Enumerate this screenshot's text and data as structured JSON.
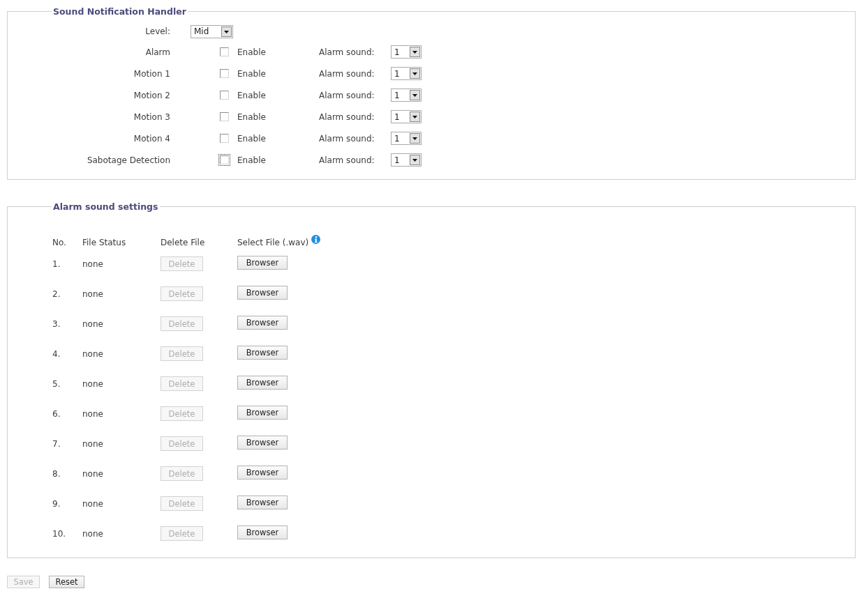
{
  "sound_notification_handler": {
    "title": "Sound Notification Handler",
    "level": {
      "label": "Level:",
      "value": "Mid"
    },
    "events": [
      {
        "name": "Alarm",
        "checked": false,
        "focused": false,
        "checkbox_label": "Enable",
        "sound_label": "Alarm sound:",
        "sound": "1"
      },
      {
        "name": "Motion 1",
        "checked": false,
        "focused": false,
        "checkbox_label": "Enable",
        "sound_label": "Alarm sound:",
        "sound": "1"
      },
      {
        "name": "Motion 2",
        "checked": false,
        "focused": false,
        "checkbox_label": "Enable",
        "sound_label": "Alarm sound:",
        "sound": "1"
      },
      {
        "name": "Motion 3",
        "checked": false,
        "focused": false,
        "checkbox_label": "Enable",
        "sound_label": "Alarm sound:",
        "sound": "1"
      },
      {
        "name": "Motion 4",
        "checked": false,
        "focused": false,
        "checkbox_label": "Enable",
        "sound_label": "Alarm sound:",
        "sound": "1"
      },
      {
        "name": "Sabotage Detection",
        "checked": false,
        "focused": true,
        "checkbox_label": "Enable",
        "sound_label": "Alarm sound:",
        "sound": "1"
      }
    ]
  },
  "alarm_sound_settings": {
    "title": "Alarm sound settings",
    "columns": [
      "No.",
      "File Status",
      "Delete File",
      "Select File (.wav)"
    ],
    "rows": [
      {
        "no": "1.",
        "status": "none",
        "delete": {
          "label": "Delete",
          "disabled": true
        },
        "select": "Browser"
      },
      {
        "no": "2.",
        "status": "none",
        "delete": {
          "label": "Delete",
          "disabled": true
        },
        "select": "Browser"
      },
      {
        "no": "3.",
        "status": "none",
        "delete": {
          "label": "Delete",
          "disabled": true
        },
        "select": "Browser"
      },
      {
        "no": "4.",
        "status": "none",
        "delete": {
          "label": "Delete",
          "disabled": true
        },
        "select": "Browser"
      },
      {
        "no": "5.",
        "status": "none",
        "delete": {
          "label": "Delete",
          "disabled": true
        },
        "select": "Browser"
      },
      {
        "no": "6.",
        "status": "none",
        "delete": {
          "label": "Delete",
          "disabled": true
        },
        "select": "Browser"
      },
      {
        "no": "7.",
        "status": "none",
        "delete": {
          "label": "Delete",
          "disabled": true
        },
        "select": "Browser"
      },
      {
        "no": "8.",
        "status": "none",
        "delete": {
          "label": "Delete",
          "disabled": true
        },
        "select": "Browser"
      },
      {
        "no": "9.",
        "status": "none",
        "delete": {
          "label": "Delete",
          "disabled": true
        },
        "select": "Browser"
      },
      {
        "no": "10.",
        "status": "none",
        "delete": {
          "label": "Delete",
          "disabled": true
        },
        "select": "Browser"
      }
    ]
  },
  "buttons": [
    {
      "label": "Save",
      "disabled": true
    },
    {
      "label": "Reset",
      "disabled": false
    }
  ]
}
